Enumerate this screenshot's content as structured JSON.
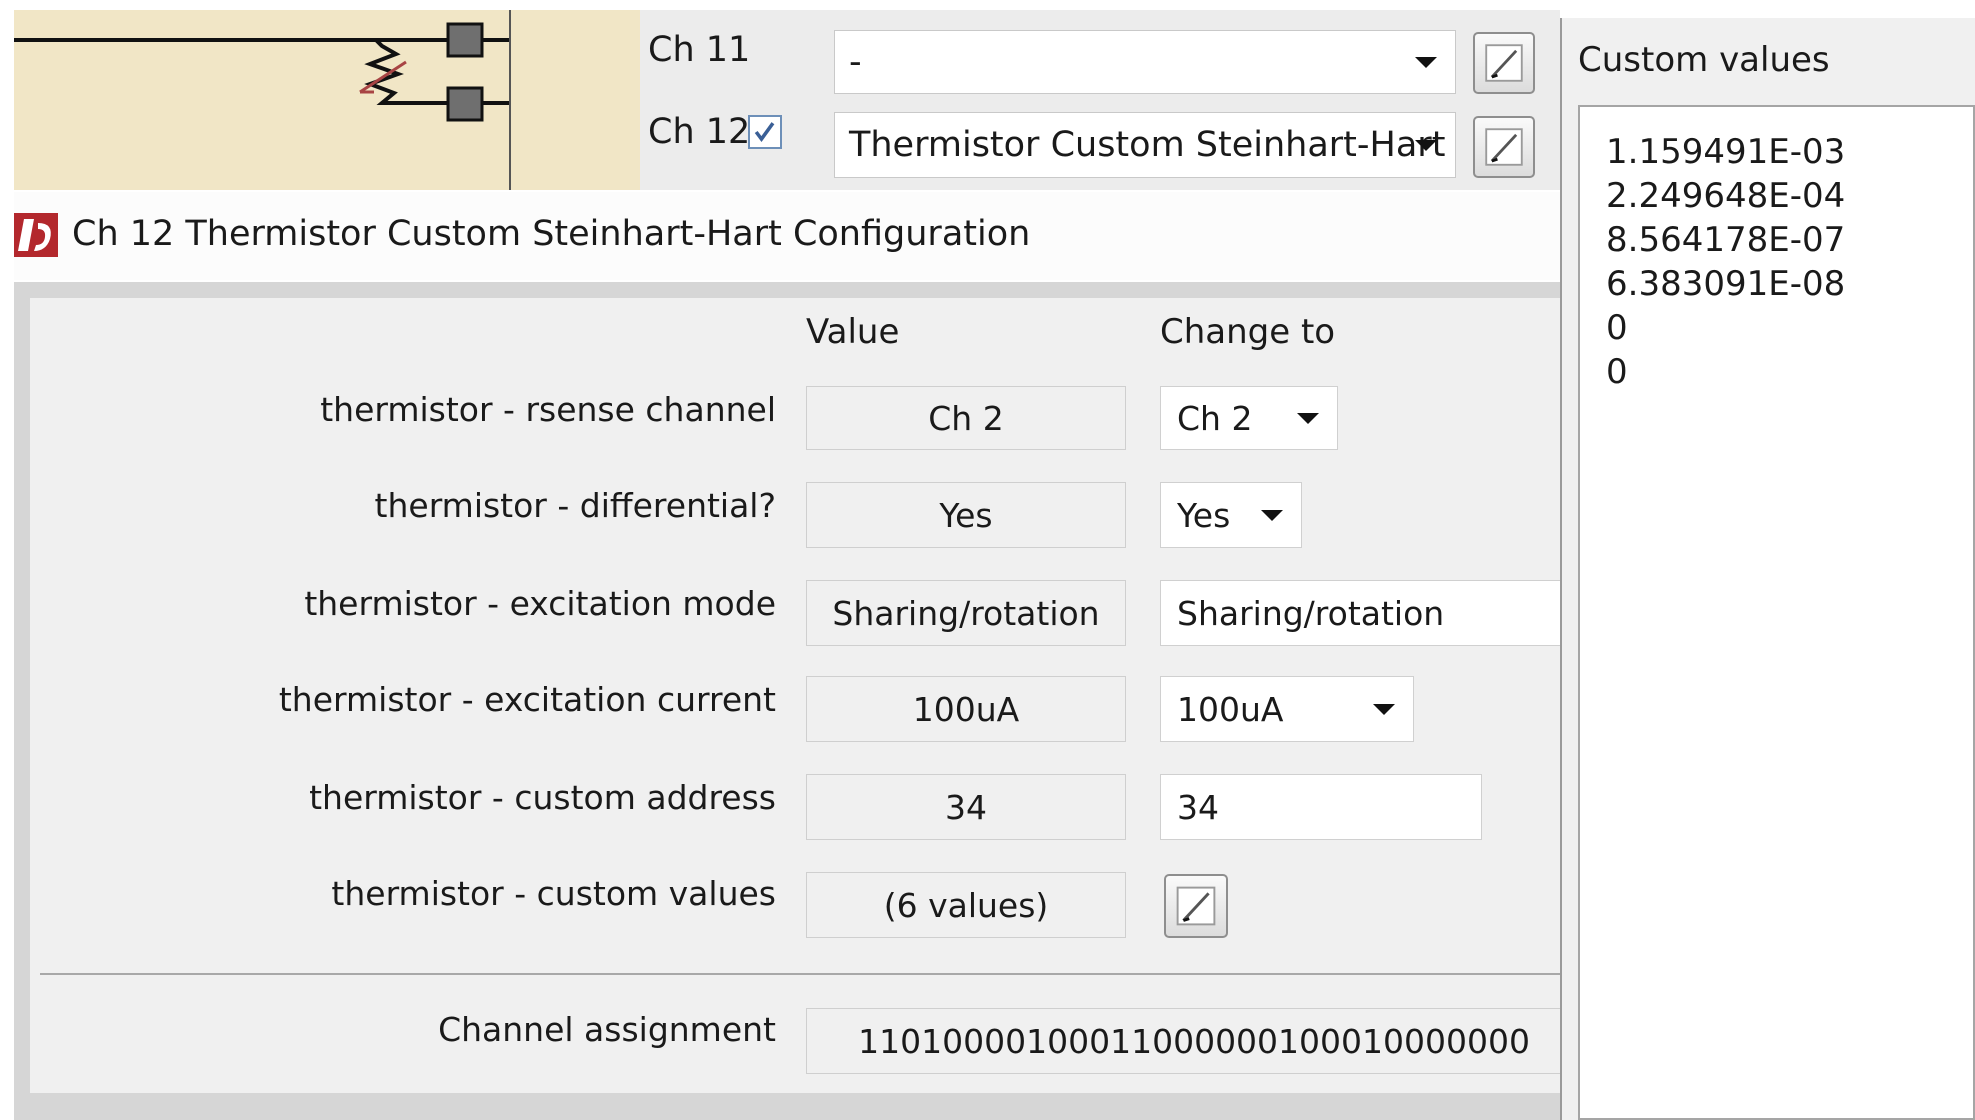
{
  "channels": [
    {
      "label": "Ch 11",
      "checked": false,
      "assignment": "-"
    },
    {
      "label": "Ch 12",
      "checked": true,
      "assignment": "Thermistor Custom Steinhart-Hart"
    }
  ],
  "dialog": {
    "title": "Ch 12 Thermistor Custom Steinhart-Hart Configuration",
    "col_value": "Value",
    "col_change": "Change to",
    "rows": [
      {
        "label": "thermistor - rsense channel",
        "value": "Ch 2",
        "change": "Ch 2"
      },
      {
        "label": "thermistor - differential?",
        "value": "Yes",
        "change": "Yes"
      },
      {
        "label": "thermistor - excitation mode",
        "value": "Sharing/rotation",
        "change": "Sharing/rotation"
      },
      {
        "label": "thermistor - excitation current",
        "value": "100uA",
        "change": "100uA"
      },
      {
        "label": "thermistor - custom address",
        "value": "34",
        "change": "34"
      },
      {
        "label": "thermistor - custom values",
        "value": "(6 values)"
      }
    ],
    "assignment_label": "Channel assignment",
    "assignment_value": "11010000100011000000100010000000"
  },
  "custom_values": {
    "title": "Custom values",
    "items": [
      "1.159491E-03",
      "2.249648E-04",
      "8.564178E-07",
      "6.383091E-08",
      "0",
      "0"
    ]
  },
  "icons": {
    "edit": "edit-pencil-icon",
    "checkbox": "checkbox-checked-icon",
    "logo": "app-logo-icon",
    "dropdown": "chevron-down-icon",
    "resistor": "thermistor-symbol-icon"
  },
  "colors": {
    "schematic_bg": "#f1e6c6",
    "logo_red": "#b3282d",
    "dialog_bg": "#f0f0f0"
  }
}
